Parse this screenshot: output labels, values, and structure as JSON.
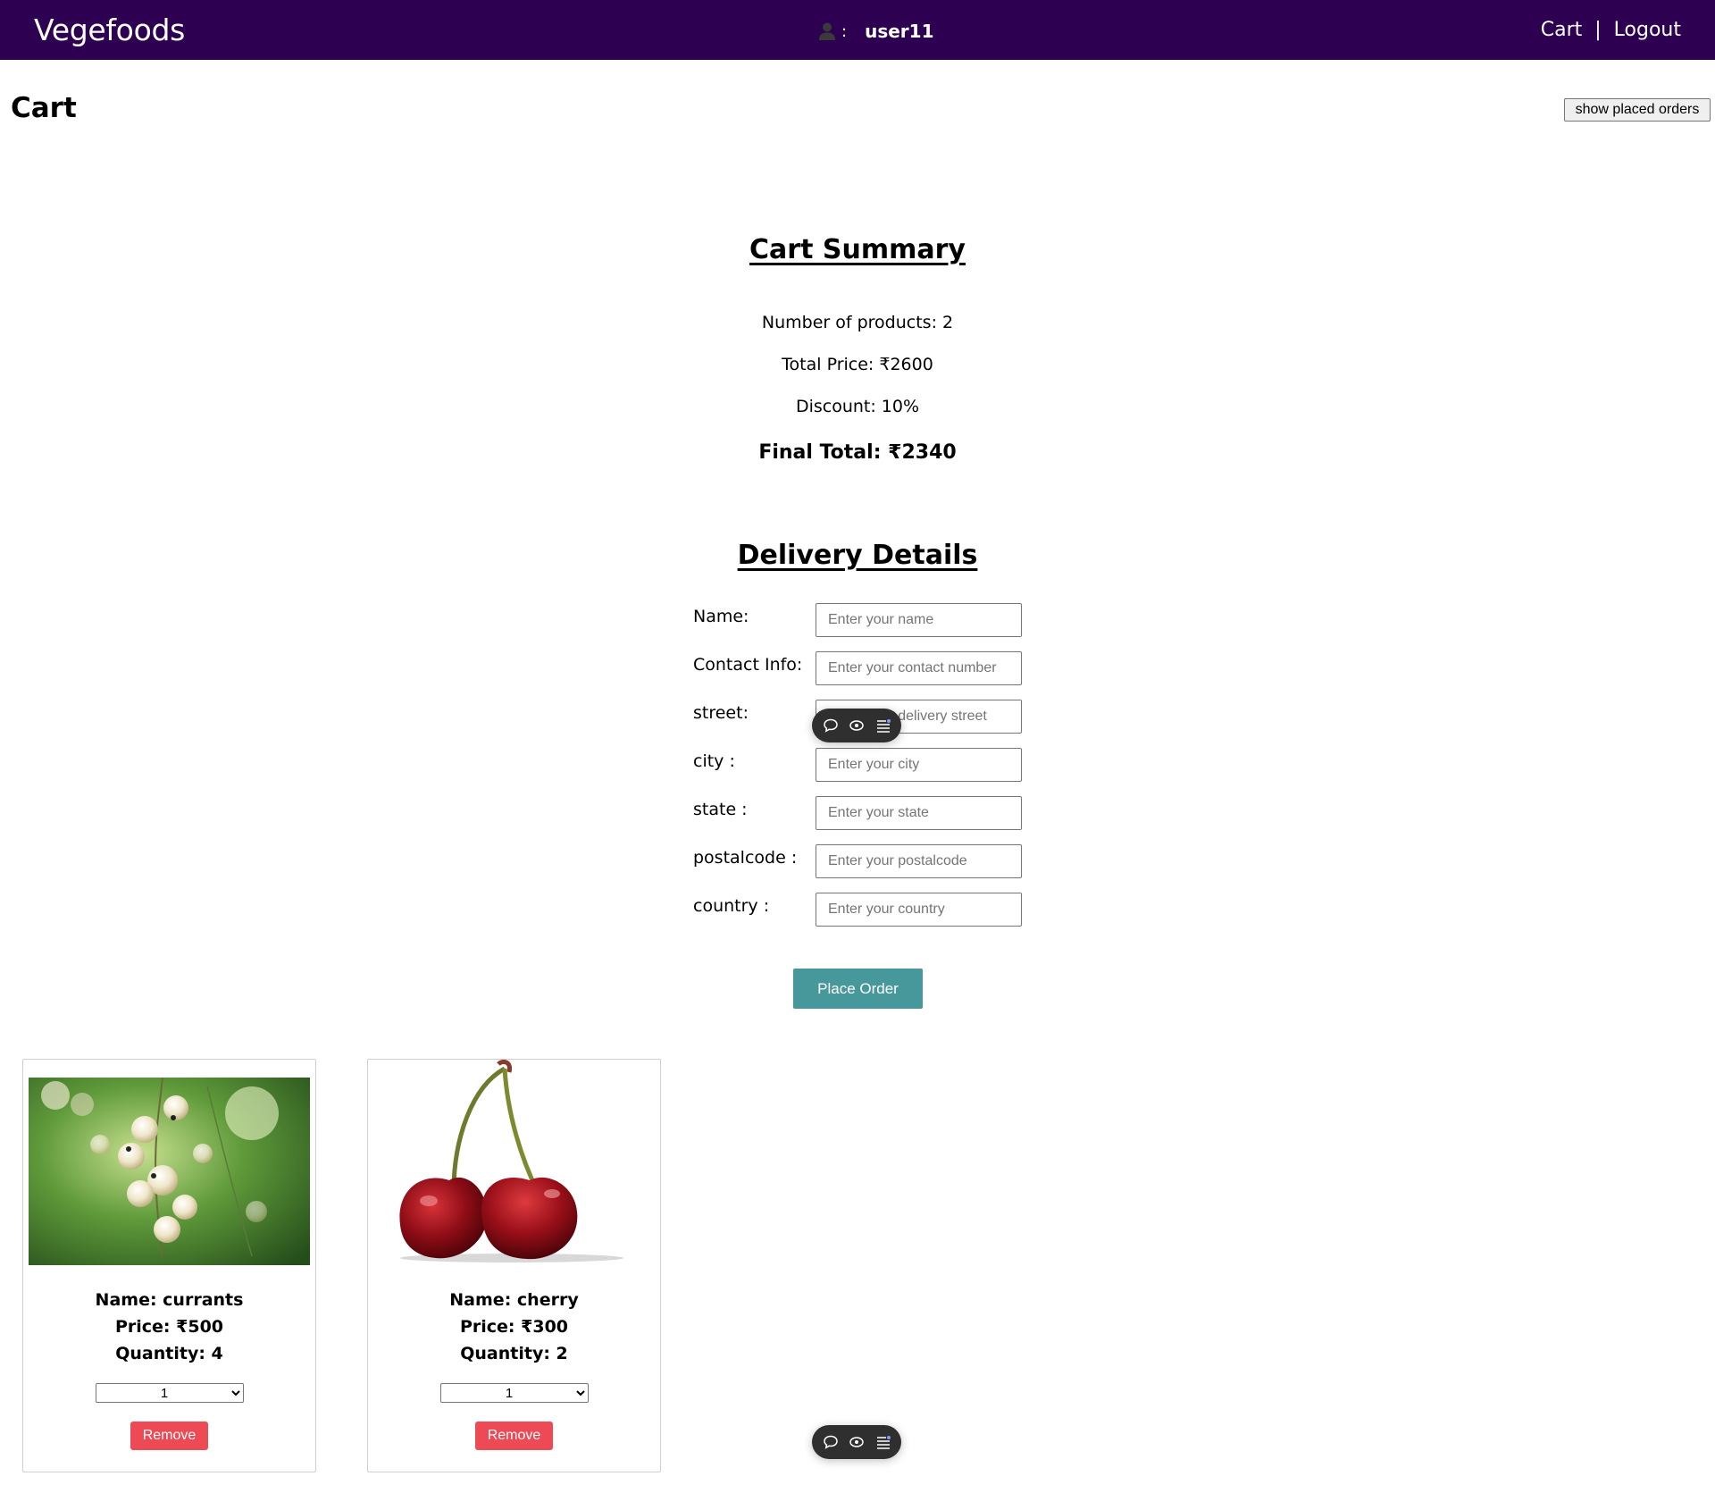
{
  "header": {
    "brand": "Vegefoods",
    "user_separator": ":",
    "username": "user11",
    "cart_link": "Cart",
    "link_divider": "|",
    "logout_link": "Logout",
    "background_color": "#2e0052"
  },
  "page": {
    "title": "Cart",
    "show_orders_button": "show placed orders"
  },
  "summary": {
    "heading": "Cart Summary",
    "products_line": "Number of products: 2",
    "total_line": "Total Price: ₹2600",
    "discount_line": "Discount: 10%",
    "final_total_line": "Final Total: ₹2340"
  },
  "delivery": {
    "heading": "Delivery Details",
    "fields": [
      {
        "label": "Name:",
        "placeholder": "Enter your name"
      },
      {
        "label": "Contact Info:",
        "placeholder": "Enter your contact number"
      },
      {
        "label": "street:",
        "placeholder": "Enter your delivery street"
      },
      {
        "label": "city :",
        "placeholder": "Enter your city"
      },
      {
        "label": "state :",
        "placeholder": "Enter your state"
      },
      {
        "label": "postalcode :",
        "placeholder": "Enter your postalcode"
      },
      {
        "label": "country :",
        "placeholder": "Enter your country"
      }
    ],
    "place_order_button": "Place Order",
    "button_color": "#46989b"
  },
  "floating_toolbar": {
    "icons": [
      "comment-icon",
      "eye-icon",
      "list-icon"
    ]
  },
  "products": [
    {
      "name_line": "Name: currants",
      "price_line": "Price: ₹500",
      "quantity_line": "Quantity: 4",
      "selected_qty": "1",
      "remove_button": "Remove"
    },
    {
      "name_line": "Name: cherry",
      "price_line": "Price: ₹300",
      "quantity_line": "Quantity: 2",
      "selected_qty": "1",
      "remove_button": "Remove"
    }
  ],
  "remove_button_color": "#ee4a55"
}
